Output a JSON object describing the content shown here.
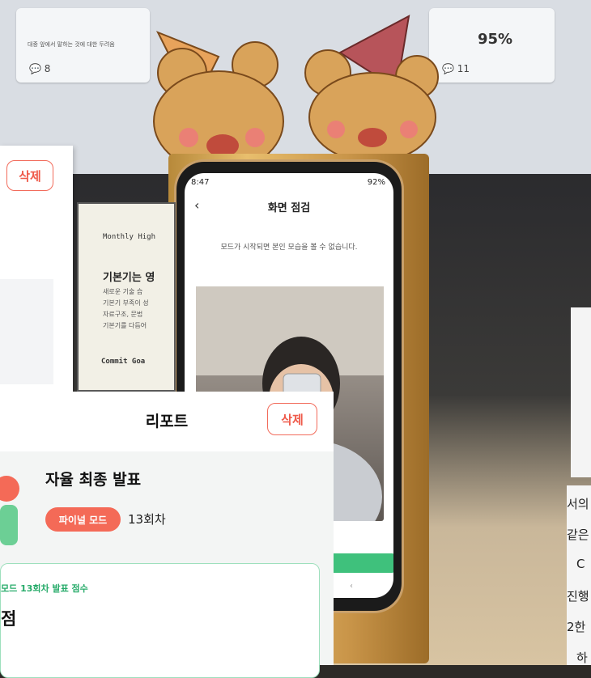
{
  "monitor": {
    "cards": [
      {
        "subtitle": "대중 앞에서 말하는 것에 대한 두려움",
        "count": "8"
      },
      {
        "percent": "95%",
        "count": "11"
      }
    ]
  },
  "notebook": {
    "heading": "Monthly High",
    "title": "기본기는 영",
    "body": "새로운 기술 습\n기본기 부족이 성\n자료구조, 문법\n기본기를 다듬어",
    "commit": "Commit Goa"
  },
  "left_panel": {
    "delete_label": "삭제"
  },
  "phone": {
    "status_time": "8:47",
    "status_right": "92%",
    "back_glyph": "‹",
    "title": "화면 점검",
    "notice": "모드가 시작되면 본인 모습을 볼 수 없습니다.",
    "nav_back_glyph": "‹"
  },
  "report": {
    "title": "리포트",
    "delete_label": "삭제",
    "session_title": "자율 최종 발표",
    "mode_badge": "파이널 모드",
    "round": "13회차",
    "score_caption": "모드 13회차 발표 점수",
    "score_unit": "점"
  },
  "right_fragments": [
    "서의",
    "같은",
    "C",
    "진행",
    "2한",
    "하"
  ],
  "colors": {
    "accent_red": "#f26b5b",
    "accent_green": "#3fc17c"
  }
}
